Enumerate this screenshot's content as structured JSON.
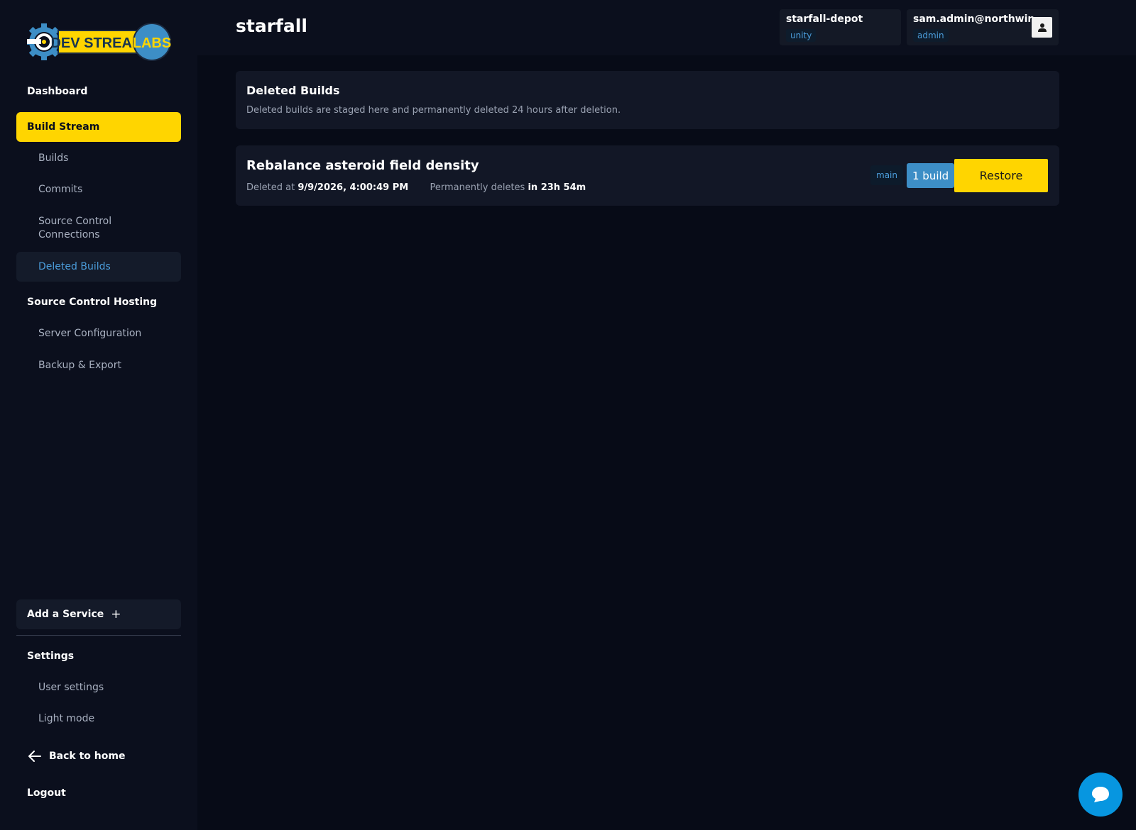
{
  "brand": {
    "logo_text_primary": "DEV STREAM",
    "logo_text_secondary": "LABS"
  },
  "sidebar": {
    "dashboard": "Dashboard",
    "build_stream": "Build Stream",
    "builds": "Builds",
    "commits": "Commits",
    "source_control_connections": "Source Control Connections",
    "deleted_builds": "Deleted Builds",
    "source_control_hosting": "Source Control Hosting",
    "server_configuration": "Server Configuration",
    "backup_export": "Backup & Export",
    "add_service": "Add a Service",
    "add_service_icon": "plus-icon",
    "settings": "Settings",
    "user_settings": "User settings",
    "light_mode": "Light mode",
    "back_to_home": "Back to home",
    "logout": "Logout"
  },
  "header": {
    "title": "starfall",
    "project": {
      "name": "starfall-depot",
      "tag": "unity"
    },
    "user": {
      "name": "sam.admin@northwin...",
      "role": "admin"
    }
  },
  "info": {
    "title": "Deleted Builds",
    "description": "Deleted builds are staged here and permanently deleted 24 hours after deletion."
  },
  "deleted_build": {
    "title": "Rebalance asteroid field density",
    "deleted_at_label": "Deleted at",
    "deleted_at_value": "9/9/2026, 4:00:49 PM",
    "permanent_label": "Permanently deletes",
    "permanent_value": "in 23h 54m",
    "branch": "main",
    "build_count": "1 build",
    "restore_label": "Restore"
  },
  "colors": {
    "accent_yellow": "#ffd500",
    "accent_blue": "#4b9ddb",
    "chat_blue": "#0796e0",
    "background": "#070b17"
  }
}
